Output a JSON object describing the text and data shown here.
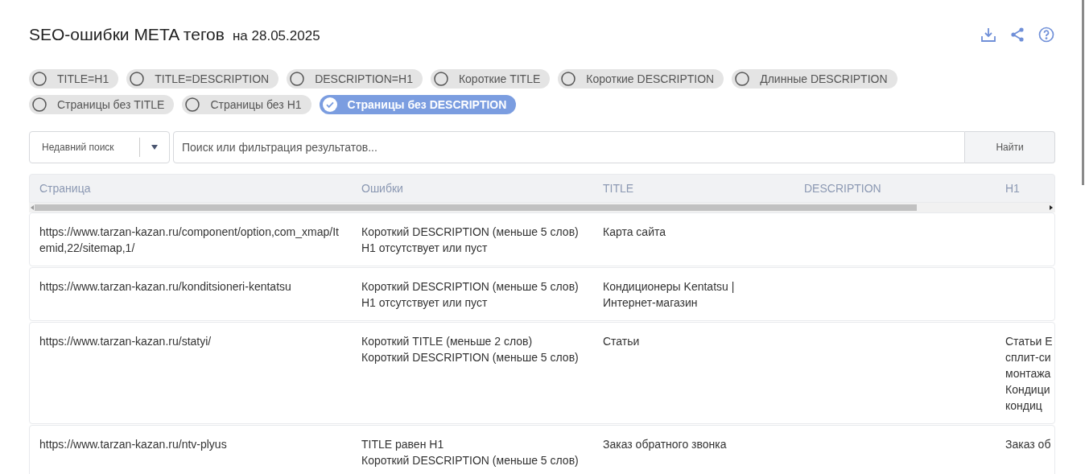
{
  "header": {
    "title": "SEO-ошибки META тегов",
    "date": "на 28.05.2025"
  },
  "filters": [
    {
      "label": "TITLE=H1",
      "selected": false
    },
    {
      "label": "TITLE=DESCRIPTION",
      "selected": false
    },
    {
      "label": "DESCRIPTION=H1",
      "selected": false
    },
    {
      "label": "Короткие TITLE",
      "selected": false
    },
    {
      "label": "Короткие DESCRIPTION",
      "selected": false
    },
    {
      "label": "Длинные DESCRIPTION",
      "selected": false
    },
    {
      "label": "Страницы без TITLE",
      "selected": false
    },
    {
      "label": "Страницы без H1",
      "selected": false
    },
    {
      "label": "Страницы без DESCRIPTION",
      "selected": true
    }
  ],
  "search": {
    "recent_label": "Недавний поиск",
    "placeholder": "Поиск или фильтрация результатов...",
    "button": "Найти"
  },
  "table": {
    "columns": [
      "Страница",
      "Ошибки",
      "TITLE",
      "DESCRIPTION",
      "H1"
    ],
    "rows": [
      {
        "page": "https://www.tarzan-kazan.ru/component/option,com_xmap/Itemid,22/sitemap,1/",
        "errors": [
          "Короткий DESCRIPTION (меньше 5 слов)",
          "H1 отсутствует или пуст"
        ],
        "title": "Карта сайта",
        "h1": []
      },
      {
        "page": "https://www.tarzan-kazan.ru/konditsioneri-kentatsu",
        "errors": [
          "Короткий DESCRIPTION (меньше 5 слов)",
          "H1 отсутствует или пуст"
        ],
        "title": "Кондиционеры Kentatsu | Интернет-магазин",
        "h1": []
      },
      {
        "page": "https://www.tarzan-kazan.ru/statyi/",
        "errors": [
          "Короткий TITLE (меньше 2 слов)",
          "Короткий DESCRIPTION (меньше 5 слов)"
        ],
        "title": "Статьи",
        "h1": [
          "Статьи Е",
          "сплит-си",
          "монтажа",
          "Кондици",
          "кондиц"
        ]
      },
      {
        "page": "https://www.tarzan-kazan.ru/ntv-plyus",
        "errors": [
          "TITLE равен H1",
          "Короткий DESCRIPTION (меньше 5 слов)"
        ],
        "title": "Заказ обратного звонка",
        "h1": [
          "Заказ об"
        ]
      }
    ]
  }
}
